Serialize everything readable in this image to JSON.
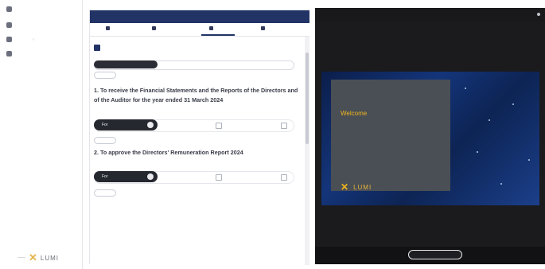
{
  "sidebar": {
    "top_label": "",
    "items": [
      {
        "label": "",
        "icon": "home-icon"
      },
      {
        "label": "",
        "icon": "document-icon"
      },
      {
        "label": "",
        "icon": "user-icon"
      }
    ],
    "brand": "LUMI"
  },
  "panel": {
    "title": "",
    "tabs": [
      "",
      "",
      "",
      ""
    ],
    "section_title": "",
    "help_text": "",
    "filters": {
      "first": "",
      "second": "",
      "third": "",
      "action": ""
    },
    "questions": [
      {
        "title": "1. To receive the Financial Statements and the Reports of the Directors and of the Auditor for the year ended 31 March 2024",
        "options": {
          "for": "For",
          "against": "",
          "withheld": ""
        },
        "action": ""
      },
      {
        "title": "2. To approve the Directors' Remuneration Report 2024",
        "options": {
          "for": "For",
          "against": "",
          "withheld": ""
        },
        "action": ""
      }
    ]
  },
  "video": {
    "title": "",
    "welcome_title": "Welcome",
    "welcome_sub": "",
    "brand": "LUMI",
    "record_label": ""
  },
  "colors": {
    "primary_navy": "#223466",
    "gold": "#f0b61e",
    "dark": "#25282f"
  }
}
